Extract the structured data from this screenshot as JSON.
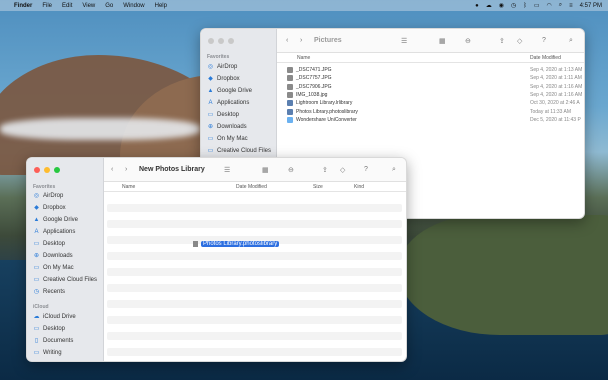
{
  "menubar": {
    "apple": "",
    "items": [
      "Finder",
      "File",
      "Edit",
      "View",
      "Go",
      "Window",
      "Help"
    ],
    "time": "4:57 PM"
  },
  "back_window": {
    "title": "Pictures",
    "sidebar_section": "Favorites",
    "sidebar": [
      "AirDrop",
      "Dropbox",
      "Google Drive",
      "Applications",
      "Desktop",
      "Downloads",
      "On My Mac",
      "Creative Cloud Files"
    ],
    "col_name": "Name",
    "col_date": "Date Modified",
    "files": [
      {
        "name": "_DSC7471.JPG",
        "date": "Sep 4, 2020 at 1:13 AM"
      },
      {
        "name": "_DSC7757.JPG",
        "date": "Sep 4, 2020 at 1:11 AM"
      },
      {
        "name": "_DSC7906.JPG",
        "date": "Sep 4, 2020 at 1:16 AM"
      },
      {
        "name": "IMG_1038.jpg",
        "date": "Sep 4, 2020 at 1:16 AM"
      },
      {
        "name": "Lightroom Library.lrlibrary",
        "date": "Oct 30, 2020 at 2:46 A"
      },
      {
        "name": "Photos Library.photoslibrary",
        "date": "Today at 11:33 AM"
      },
      {
        "name": "Wondershare UniConverter",
        "date": "Dec 5, 2020 at 11:43 P"
      }
    ]
  },
  "front_window": {
    "title": "New Photos Library",
    "sidebar_section_fav": "Favorites",
    "sidebar_fav": [
      "AirDrop",
      "Dropbox",
      "Google Drive",
      "Applications",
      "Desktop",
      "Downloads",
      "On My Mac",
      "Creative Cloud Files",
      "Recents"
    ],
    "sidebar_section_icloud": "iCloud",
    "sidebar_icloud": [
      "iCloud Drive",
      "Desktop",
      "Documents",
      "Writing"
    ],
    "col_name": "Name",
    "col_date": "Date Modified",
    "col_size": "Size",
    "col_kind": "Kind",
    "dragged_item": "Photos Library.photoslibrary"
  }
}
